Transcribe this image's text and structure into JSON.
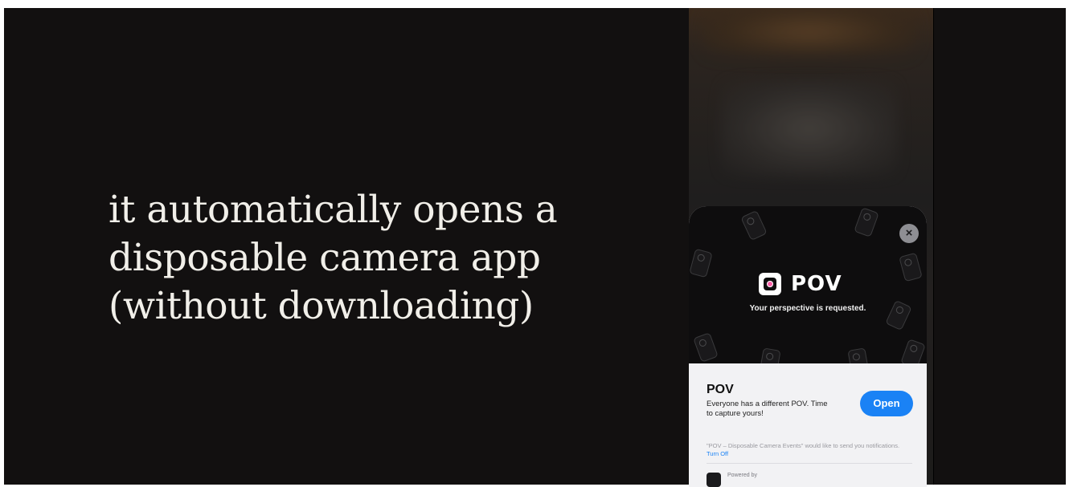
{
  "caption": {
    "lines": [
      "it automatically opens a",
      "disposable camera app",
      "(without downloading)"
    ]
  },
  "app_clip": {
    "brand": "POV",
    "tagline": "Your perspective is requested.",
    "close_icon": "close-icon",
    "app_name": "POV",
    "description": "Everyone has a different POV. Time to capture yours!",
    "open_label": "Open",
    "notification_text": "\"POV – Disposable Camera Events\" would like to send you notifications.",
    "turn_off_label": "Turn Off",
    "powered_by": "Powered by"
  },
  "colors": {
    "background": "#121010",
    "caption_text": "#f1efe9",
    "open_button": "#1a82f5",
    "logo_dot": "#ff5fa8"
  }
}
